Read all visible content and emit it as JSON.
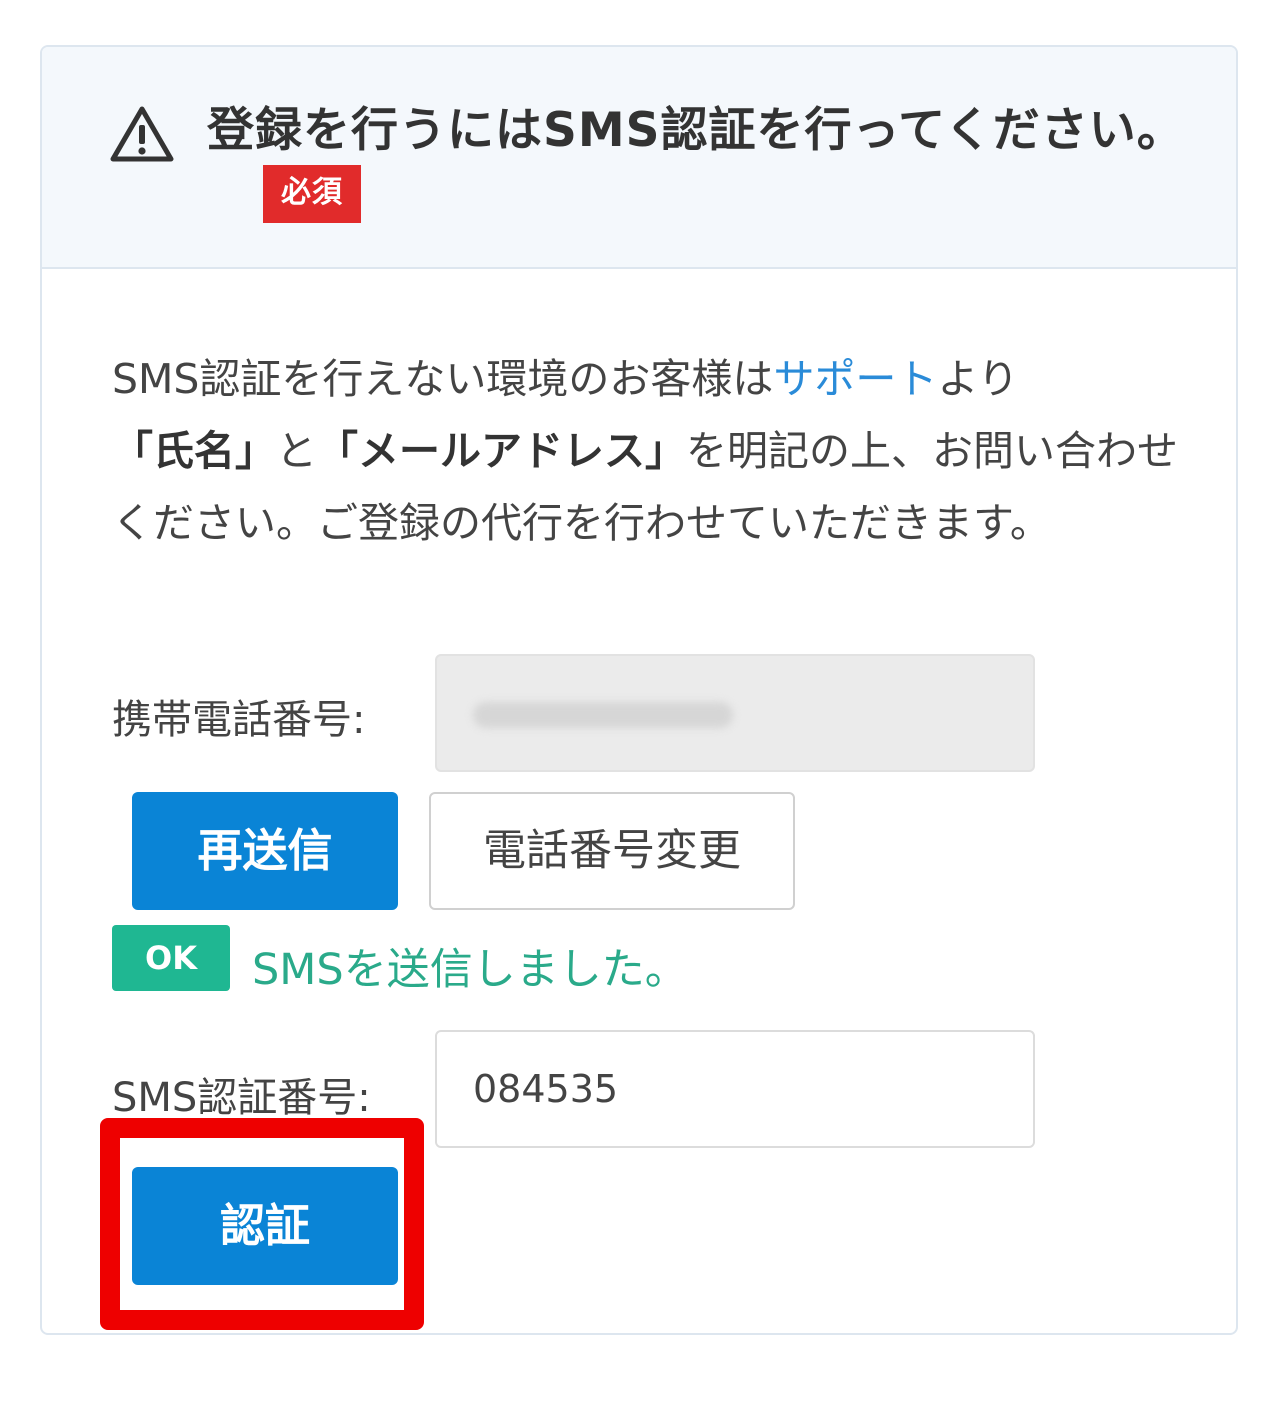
{
  "header": {
    "title": "登録を行うにはSMS認証を行ってください。",
    "required_badge": "必須",
    "icon": "warning-triangle-icon"
  },
  "description": {
    "part1": "SMS認証を行えない環境のお客様は",
    "support_link": "サポート",
    "part2": "より",
    "name_text": "「氏名」",
    "part3": "と",
    "email_text": "「メールアドレス」",
    "part4": "を明記の上、お問い合わせください。ご登録の代行を行わせていただきます。"
  },
  "phone": {
    "label": "携帯電話番号:"
  },
  "buttons": {
    "resend_label": "再送信",
    "change_phone_label": "電話番号変更",
    "verify_label": "認証"
  },
  "status": {
    "badge": "OK",
    "message": "SMSを送信しました。"
  },
  "sms_code": {
    "label": "SMS認証番号:",
    "value": "084535"
  },
  "colors": {
    "primary": "#0a84d6",
    "required": "#e12b2b",
    "success": "#1fb792",
    "success_text": "#2aaa8a",
    "link": "#2a8bd8",
    "highlight": "#ee0000",
    "header_bg": "#f4f8fc"
  }
}
